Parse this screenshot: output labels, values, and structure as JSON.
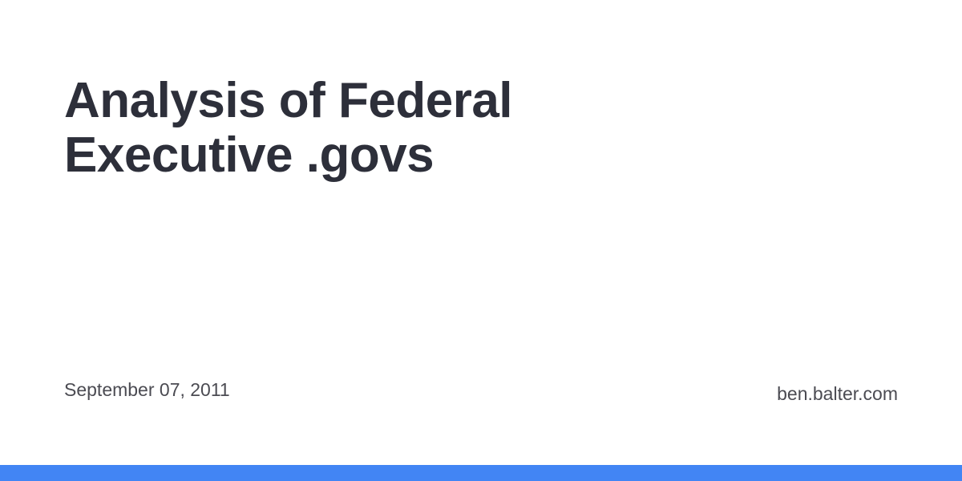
{
  "title": {
    "line1": "Analysis of Federal",
    "line2": "Executive .govs"
  },
  "date": "September 07, 2011",
  "site": "ben.balter.com",
  "colors": {
    "accent_bar": "#4285f4",
    "text_primary": "#2d2f3a",
    "text_secondary": "#4b4b52",
    "background": "#ffffff"
  }
}
